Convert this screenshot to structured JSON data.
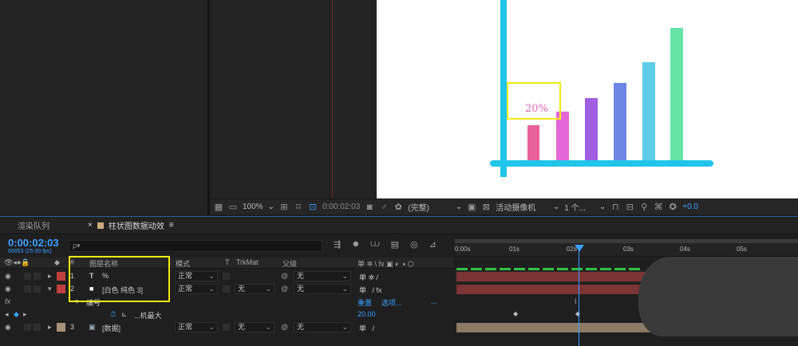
{
  "viewer": {
    "chart_label": "20%",
    "toolbar": {
      "zoom": "100%",
      "timecode": "0:00:02:03",
      "resolution": "(完整)",
      "camera": "活动摄像机",
      "views": "1 个...",
      "exposure": "+0.0"
    }
  },
  "timeline": {
    "tabs": [
      {
        "label": "渲染队列"
      },
      {
        "label": "柱状图数据动效"
      }
    ],
    "timecode": "0:00:02:03",
    "fps": "00053 (25.00 fps)",
    "search_placeholder": "ρ▾",
    "columns": {
      "hash": "#",
      "layer_name": "图层名称",
      "mode": "模式",
      "t": "T",
      "trkmat": "TrkMat",
      "parent": "父级",
      "switches": "单 ✲ \\ fx ▣ ◐ ◑ ⬡"
    },
    "layers": [
      {
        "num": "1",
        "type_icon": "T",
        "name": "%",
        "mode": "正常",
        "trkmat": "",
        "parent": "无",
        "color": "#c04040"
      },
      {
        "num": "2",
        "type_icon": "■",
        "name": "[白色 纯色 3]",
        "mode": "正常",
        "trkmat": "无",
        "parent": "无",
        "color": "#c04040"
      },
      {
        "num": "3",
        "type_icon": "▣",
        "name": "[数据]",
        "mode": "正常",
        "trkmat": "无",
        "parent": "无",
        "color": "#a89078"
      }
    ],
    "effect_row": {
      "fx": "fx",
      "name": "编号",
      "reset": "重置",
      "about": "选项...",
      "dots": "..."
    },
    "property_row": {
      "name": "...机最大",
      "value": "20.00"
    },
    "ruler_ticks": [
      "0:00s",
      "01s",
      "02s",
      "03s",
      "04s",
      "05s"
    ],
    "colors": {
      "accent": "#3aa0ff",
      "highlight": "#f2ea10"
    }
  }
}
